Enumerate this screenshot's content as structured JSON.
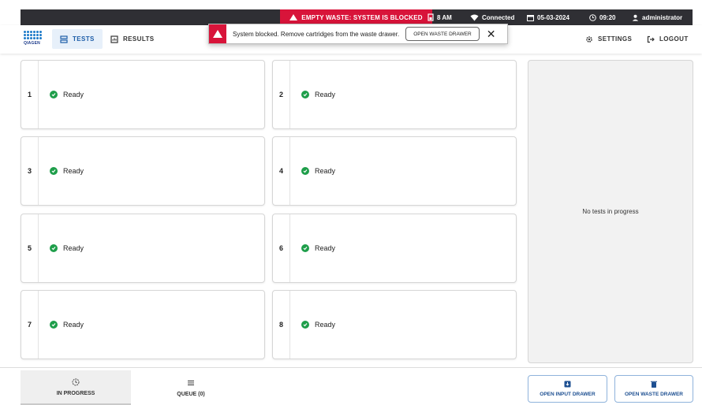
{
  "status_bar": {
    "alert": "EMPTY WASTE: SYSTEM IS BLOCKED",
    "battery": "8 AM",
    "connection": "Connected",
    "date": "05-03-2024",
    "time": "09:20",
    "user": "administrator",
    "alert_color": "#d8143a"
  },
  "nav": {
    "logo_text": "QIAGEN",
    "tabs": [
      {
        "label": "TESTS",
        "icon": "tests-icon",
        "active": true
      },
      {
        "label": "RESULTS",
        "icon": "results-icon",
        "active": false
      }
    ],
    "settings_label": "SETTINGS",
    "logout_label": "LOGOUT"
  },
  "popup": {
    "message": "System blocked. Remove cartridges from the waste drawer.",
    "button_label": "OPEN WASTE DRAWER",
    "close_symbol": "✕"
  },
  "slots": [
    {
      "number": "1",
      "status": "Ready"
    },
    {
      "number": "2",
      "status": "Ready"
    },
    {
      "number": "3",
      "status": "Ready"
    },
    {
      "number": "4",
      "status": "Ready"
    },
    {
      "number": "5",
      "status": "Ready"
    },
    {
      "number": "6",
      "status": "Ready"
    },
    {
      "number": "7",
      "status": "Ready"
    },
    {
      "number": "8",
      "status": "Ready"
    }
  ],
  "side_panel": {
    "empty_text": "No tests in progress"
  },
  "bottom": {
    "tabs": [
      {
        "label": "IN PROGRESS",
        "active": true
      },
      {
        "label": "QUEUE (0)",
        "active": false
      }
    ],
    "open_input_drawer": "OPEN INPUT DRAWER",
    "open_waste_drawer": "OPEN WASTE DRAWER"
  }
}
